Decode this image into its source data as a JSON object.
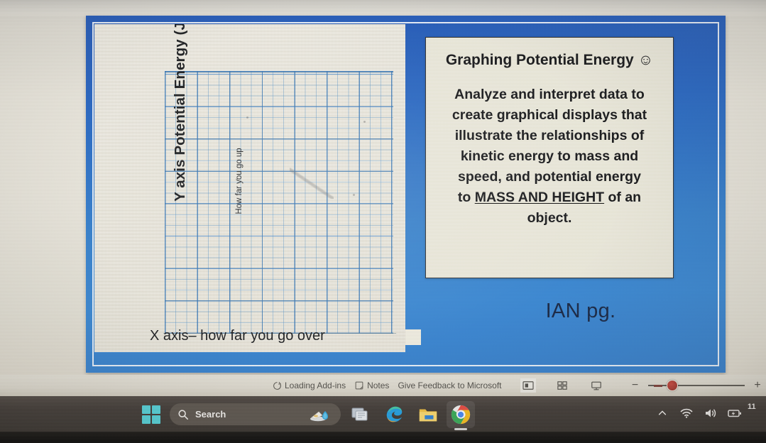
{
  "slide": {
    "graph": {
      "y_axis_label": "Y axis Potential Energy (J)",
      "y_axis_sublabel": "How far you go up",
      "x_axis_label": "X axis– how far you go over",
      "grid_color": "#5492c8",
      "paper_color": "#eeebdf"
    },
    "card": {
      "title": "Graphing Potential Energy",
      "title_emoji": "☺",
      "body_line1": "Analyze and interpret data to",
      "body_line2": "create graphical displays that",
      "body_line3": "illustrate the relationships of",
      "body_line4": "kinetic energy to mass and",
      "body_line5": "speed, and potential energy",
      "body_line6_pre": "to ",
      "body_line6_underlined": "MASS AND HEIGHT",
      "body_line6_post": " of an",
      "body_line7": "object."
    },
    "footer_note": "IAN pg.",
    "background_color": "#1f6ec7",
    "border_color": "#1551b0"
  },
  "status_bar": {
    "addins_label": "Loading Add-ins",
    "notes_label": "Notes",
    "feedback_label": "Give Feedback to Microsoft",
    "view_normal": "normal-view",
    "view_sorter": "slide-sorter-view",
    "view_reading": "reading-view",
    "zoom_minus": "−",
    "zoom_plus": "+"
  },
  "taskbar": {
    "start_label": "start-button",
    "search_placeholder": "Search",
    "apps": [
      {
        "name": "task-view",
        "label": "Task View"
      },
      {
        "name": "microsoft-edge",
        "label": "Microsoft Edge"
      },
      {
        "name": "file-explorer",
        "label": "File Explorer"
      },
      {
        "name": "google-chrome",
        "label": "Google Chrome"
      }
    ],
    "tray": {
      "chevron": "show-hidden-icons",
      "wifi": "wifi-icon",
      "volume": "volume-icon",
      "battery": "battery-icon"
    },
    "clock_time": "11"
  }
}
